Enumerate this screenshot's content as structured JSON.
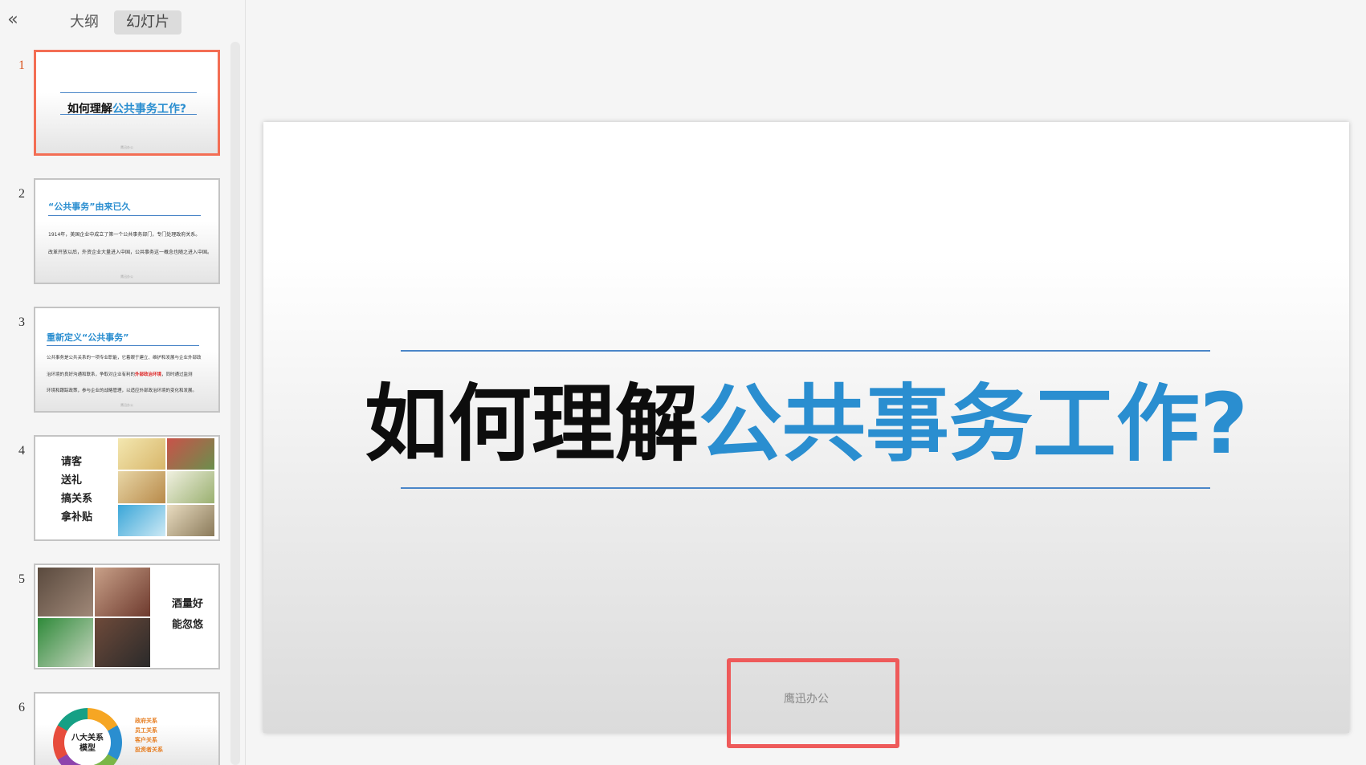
{
  "sidebar": {
    "tabs": [
      "大纲",
      "幻灯片"
    ],
    "active_tab": "幻灯片",
    "slides": [
      {
        "num": "1",
        "title_black": "如何理解",
        "title_blue": "公共事务工作?",
        "footer": "鹰迅办公"
      },
      {
        "num": "2",
        "heading": "“公共事务”由来已久",
        "para1": "1914年，美国企业中成立了第一个公共事务部门，专门处理政府关系。",
        "para2": "改革开放以后，外资企业大量进入中国，公共事务这一概念也随之进入中国。",
        "footer": "鹰迅办公"
      },
      {
        "num": "3",
        "heading": "重新定义“公共事务”",
        "line1": "公共事务是公共关系的一项专业职能，它着眼于建立、维护和发展与企业外部政",
        "line2a": "治环境的良好沟通和联系，争取对企业有利的",
        "line2b": "外部政治环境",
        "line2c": "，同时通过监测",
        "line3": "环境和跟踪政策，参与企业的战略管理，以适应外部政治环境的变化和发展。",
        "footer": "鹰迅办公"
      },
      {
        "num": "4",
        "words": [
          "请客",
          "送礼",
          "搞关系",
          "拿补贴"
        ]
      },
      {
        "num": "5",
        "words": [
          "酒量好",
          "能忽悠"
        ]
      },
      {
        "num": "6",
        "center": [
          "八大关系",
          "模型"
        ],
        "items": [
          "政府关系",
          "员工关系",
          "客户关系",
          "投资者关系"
        ]
      }
    ]
  },
  "slide": {
    "title_black": "如何理解",
    "title_blue": "公共事务工作?",
    "footer": "鹰迅办公"
  },
  "colors": {
    "accent_blue": "#2a8ed0",
    "rule_blue": "#4a86c8",
    "selection_orange": "#f36e54",
    "highlight_red": "#ee5a5a"
  },
  "icons": {
    "collapse": "double-chevron-left-icon"
  }
}
